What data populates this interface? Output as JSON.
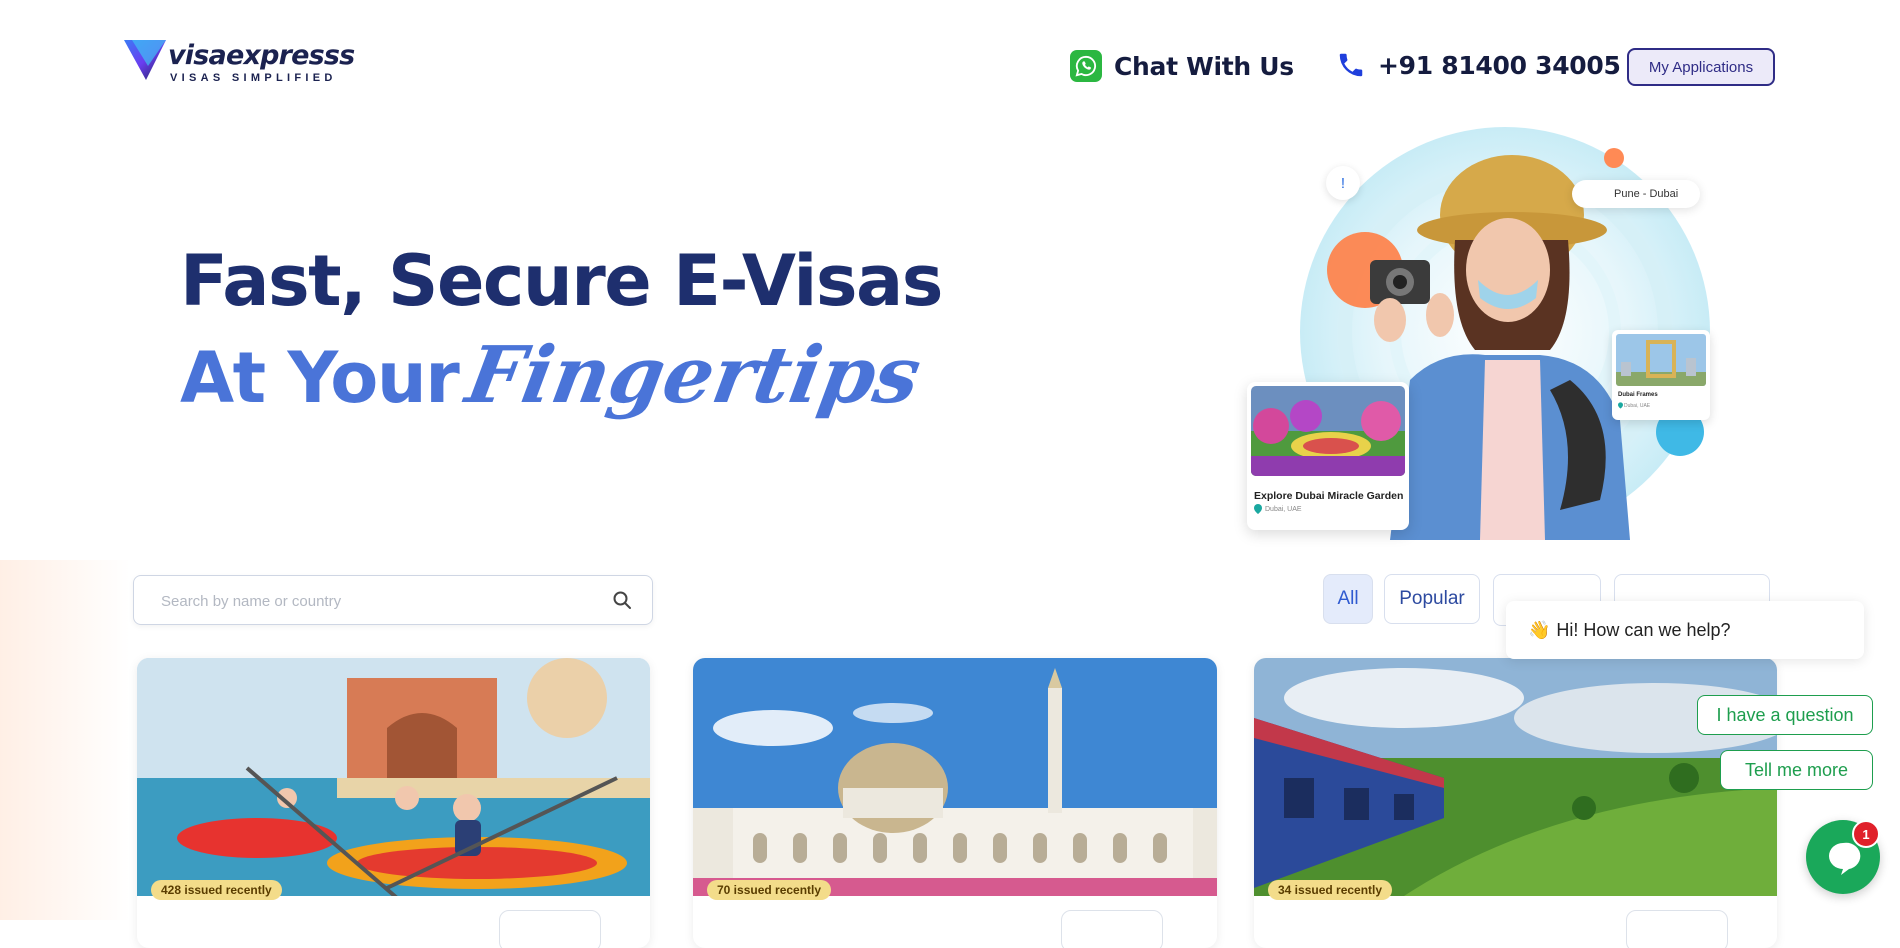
{
  "brand": {
    "name": "visaexpresss",
    "tagline": "VISAS SIMPLIFIED"
  },
  "header": {
    "chat_label": "Chat With Us",
    "phone_label": "+91 81400 34005",
    "my_applications_label": "My Applications"
  },
  "hero": {
    "line1": "Fast, Secure E-Visas",
    "line2_prefix": "At Your",
    "line2_script": "Fingertips"
  },
  "illustration": {
    "route_pill": "Pune - Dubai",
    "alert_symbol": "!",
    "card_main": {
      "title": "Explore Dubai Miracle Garden",
      "location": "Dubai, UAE"
    },
    "card_small": {
      "title": "Dubai Frames",
      "location": "Dubai, UAE"
    }
  },
  "search": {
    "placeholder": "Search by name or country"
  },
  "filters": [
    {
      "label": "All",
      "active": true
    },
    {
      "label": "Popular",
      "active": false
    }
  ],
  "cards": [
    {
      "badge": "428 issued recently",
      "scene": "beach-kayak-icon"
    },
    {
      "badge": "70 issued recently",
      "scene": "mosque-icon"
    },
    {
      "badge": "34 issued recently",
      "scene": "train-tea-icon"
    }
  ],
  "chat_widget": {
    "greeting_emoji": "👋",
    "greeting": "Hi! How can we help?",
    "options": [
      "I have a question",
      "Tell me more"
    ],
    "unread_count": "1"
  },
  "colors": {
    "navy": "#1e2f6e",
    "accent_blue": "#4a74d8",
    "whatsapp_green": "#2bb741",
    "chat_green": "#1aa85a",
    "badge_yellow": "#f3dc8a"
  }
}
